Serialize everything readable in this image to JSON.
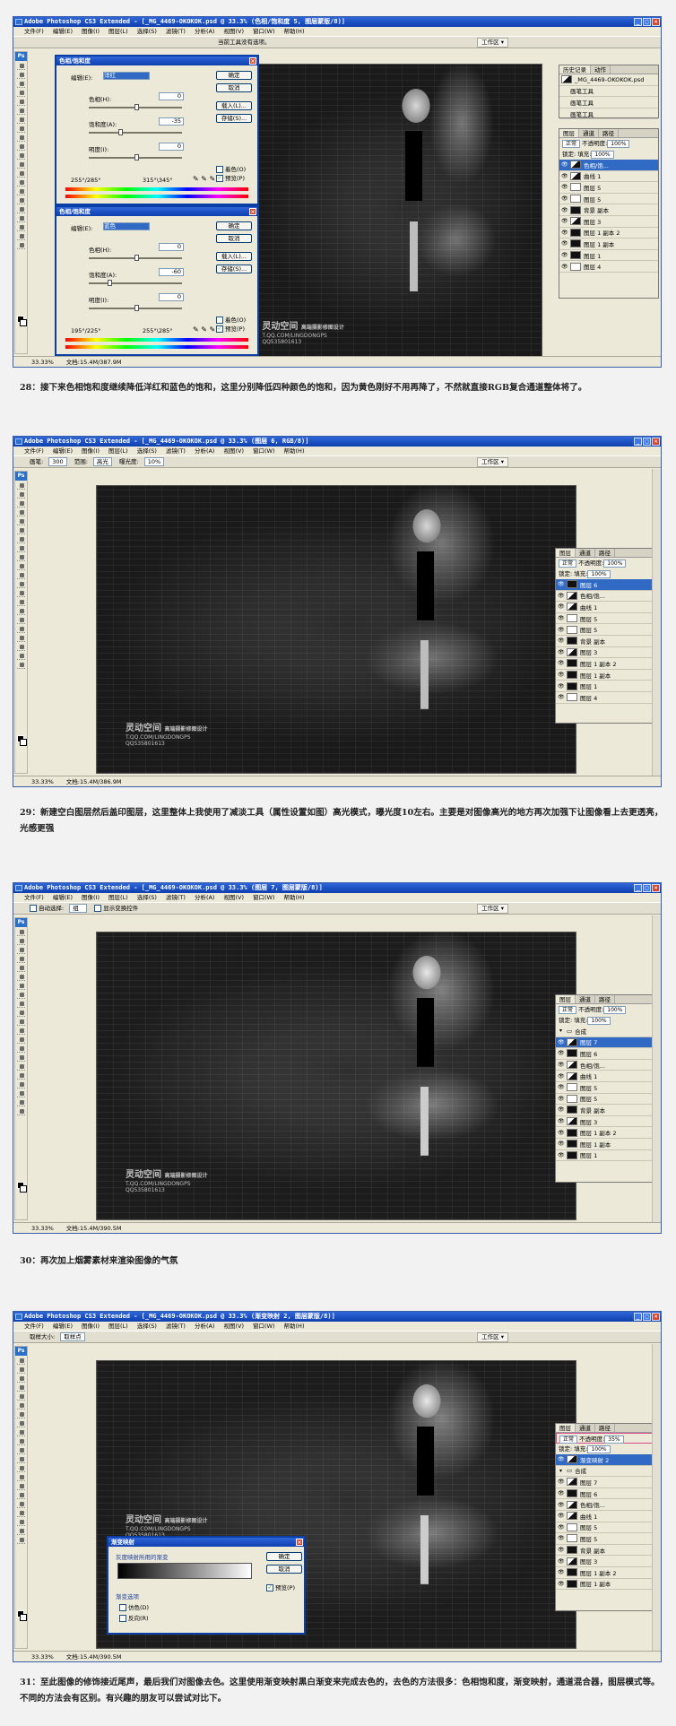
{
  "app": {
    "title_prefix": "Adobe Photoshop CS3 Extended",
    "menus": [
      "文件(F)",
      "编辑(E)",
      "图像(I)",
      "图层(L)",
      "选择(S)",
      "滤镜(T)",
      "分析(A)",
      "视图(V)",
      "窗口(W)",
      "帮助(H)"
    ],
    "workspace": "工作区"
  },
  "watermark": {
    "logo": "灵动空间",
    "sub": "T.QQ.COM/LINGDONGPS",
    "tagline": "高端摄影修图设计",
    "qq": "QQ535801613"
  },
  "screens": [
    {
      "title": "Adobe Photoshop CS3 Extended - [_MG_4469-OKOKOK.psd @ 33.3% (色相/饱和度 5, 图层蒙版/8)]",
      "options": "当前工具没有选项。",
      "zoom": "33.33%",
      "doc": "文档:15.4M/387.9M",
      "history": {
        "tabs": [
          "历史记录",
          "动作"
        ],
        "file": "_MG_4469-OKOKOK.psd",
        "items": [
          "画笔工具",
          "画笔工具",
          "画笔工具",
          "画笔工具"
        ]
      },
      "layers": {
        "tabs": [
          "图层",
          "通道",
          "路径"
        ],
        "blend": "正常",
        "opacity_label": "不透明度:",
        "opacity": "100%",
        "lock": "锁定:",
        "fill_label": "填充:",
        "fill": "100%",
        "items": [
          "色相/饱...",
          "曲线 1",
          "图层 5",
          "图层 5",
          "背景 副本",
          "图层 3",
          "图层 1 副本 2",
          "图层 1 副本",
          "图层 1",
          "图层 4"
        ]
      },
      "dialogs": [
        {
          "title": "色相/饱和度",
          "edit_label": "编辑(E):",
          "edit_value": "洋红",
          "hue_label": "色相(H):",
          "hue": "0",
          "sat_label": "饱和度(A):",
          "sat": "-35",
          "light_label": "明度(I):",
          "light": "0",
          "range_left": "255°/285°",
          "range_right": "315°\\345°",
          "ok": "确定",
          "cancel": "取消",
          "load": "载入(L)...",
          "save": "存储(S)...",
          "colorize": "着色(O)",
          "preview": "预览(P)"
        },
        {
          "title": "色相/饱和度",
          "edit_label": "编辑(E):",
          "edit_value": "蓝色",
          "hue_label": "色相(H):",
          "hue": "0",
          "sat_label": "饱和度(A):",
          "sat": "-60",
          "light_label": "明度(I):",
          "light": "0",
          "range_left": "195°/225°",
          "range_right": "255°\\285°",
          "ok": "确定",
          "cancel": "取消",
          "load": "载入(L)...",
          "save": "存储(S)...",
          "colorize": "着色(O)",
          "preview": "预览(P)"
        }
      ]
    },
    {
      "title": "Adobe Photoshop CS3 Extended - [_MG_4469-OKOKOK.psd @ 33.3% (图层 6, RGB/8)]",
      "options": {
        "brush_label": "画笔:",
        "brush": "300",
        "range_label": "范围:",
        "range": "高光",
        "exposure_label": "曝光度:",
        "exposure": "10%"
      },
      "zoom": "33.33%",
      "doc": "文档:15.4M/386.9M",
      "layers": {
        "tabs": [
          "图层",
          "通道",
          "路径"
        ],
        "blend": "正常",
        "opacity_label": "不透明度:",
        "opacity": "100%",
        "lock": "锁定:",
        "fill_label": "填充:",
        "fill": "100%",
        "items": [
          "图层 6",
          "色相/饱...",
          "曲线 1",
          "图层 5",
          "图层 5",
          "背景 副本",
          "图层 3",
          "图层 1 副本 2",
          "图层 1 副本",
          "图层 1",
          "图层 4"
        ]
      }
    },
    {
      "title": "Adobe Photoshop CS3 Extended - [_MG_4469-OKOKOK.psd @ 33.3% (图层 7, 图层蒙版/8)]",
      "options": {
        "auto_select": "自动选择:",
        "auto_target": "组",
        "show_transform": "显示变换控件"
      },
      "zoom": "33.33%",
      "doc": "文档:15.4M/390.5M",
      "layers": {
        "tabs": [
          "图层",
          "通道",
          "路径"
        ],
        "blend": "正常",
        "opacity_label": "不透明度:",
        "opacity": "100%",
        "lock": "锁定:",
        "fill_label": "填充:",
        "fill": "100%",
        "items": [
          "合成",
          "图层 7",
          "图层 6",
          "色相/饱...",
          "曲线 1",
          "图层 5",
          "图层 5",
          "背景 副本",
          "图层 3",
          "图层 1 副本 2",
          "图层 1 副本",
          "图层 1"
        ]
      }
    },
    {
      "title": "Adobe Photoshop CS3 Extended - [_MG_4469-OKOKOK.psd @ 33.3% (渐变映射 2, 图层蒙版/8)]",
      "options": {
        "sample_label": "取样大小:",
        "sample": "取样点"
      },
      "zoom": "33.33%",
      "doc": "文档:15.4M/390.5M",
      "layers": {
        "tabs": [
          "图层",
          "通道",
          "路径"
        ],
        "blend": "正常",
        "opacity_label": "不透明度:",
        "opacity": "35%",
        "lock": "锁定:",
        "fill_label": "填充:",
        "fill": "100%",
        "items": [
          "渐变映射 2",
          "合成",
          "图层 7",
          "图层 6",
          "色相/饱...",
          "曲线 1",
          "图层 5",
          "图层 5",
          "背景 副本",
          "图层 3",
          "图层 1 副本 2",
          "图层 1 副本"
        ]
      },
      "dialog": {
        "title": "渐变映射",
        "group": "灰度映射所用的渐变",
        "ok": "确定",
        "cancel": "取消",
        "preview": "预览(P)",
        "opts": "渐变选项",
        "dither": "仿色(D)",
        "reverse": "反向(R)"
      }
    }
  ],
  "captions": [
    "28：接下来色相饱和度继续降低洋红和蓝色的饱和，这里分别降低四种颜色的饱和，因为黄色刚好不用再降了，不然就直接RGB复合通道整体将了。",
    "29：新建空白图层然后盖印图层，这里整体上我使用了减淡工具（属性设置如图）高光模式，曝光度10左右。主要是对图像高光的地方再次加强下让图像看上去更透亮，光感更强",
    "30：再次加上烟雾素材来渲染图像的气氛",
    "31：至此图像的修饰接近尾声，最后我们对图像去色。这里使用渐变映射黑白渐变来完成去色的，去色的方法很多：色相饱和度，渐变映射，通道混合器，图层模式等。不同的方法会有区别。有兴趣的朋友可以尝试对比下。"
  ]
}
